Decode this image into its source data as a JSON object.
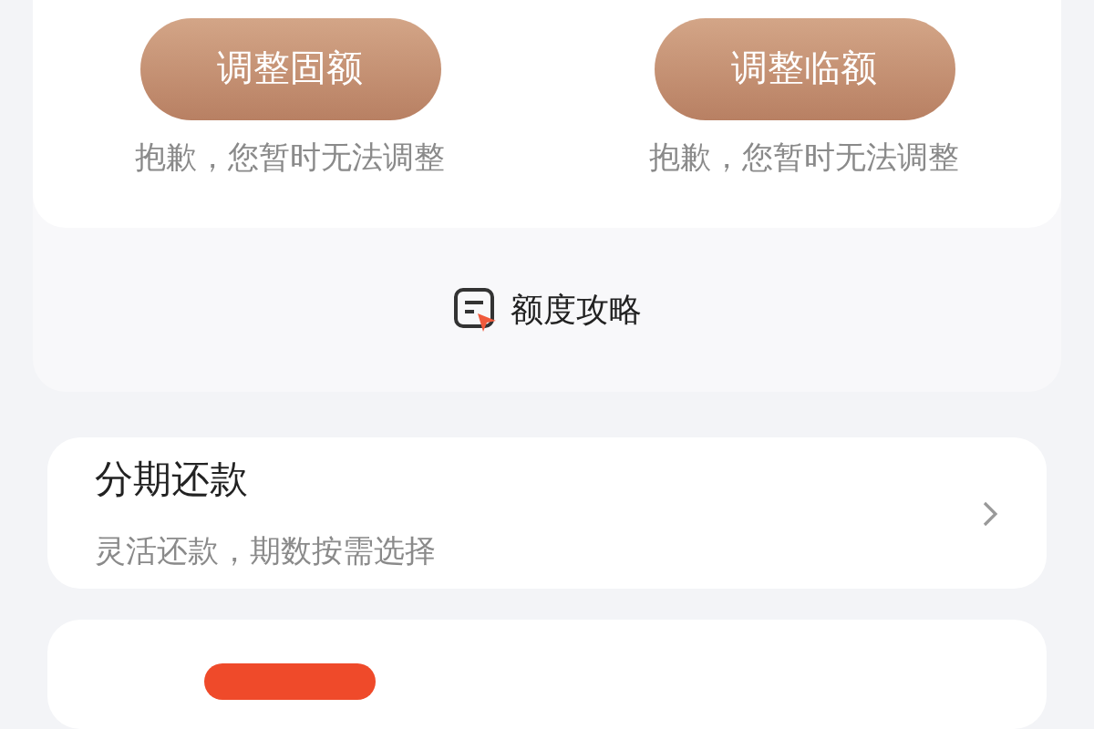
{
  "adjust_buttons": [
    {
      "label": "调整固额",
      "note": "抱歉，您暂时无法调整"
    },
    {
      "label": "调整临额",
      "note": "抱歉，您暂时无法调整"
    }
  ],
  "guide_link": {
    "label": "额度攻略"
  },
  "installment_card": {
    "title": "分期还款",
    "subtitle": "灵活还款，期数按需选择"
  }
}
